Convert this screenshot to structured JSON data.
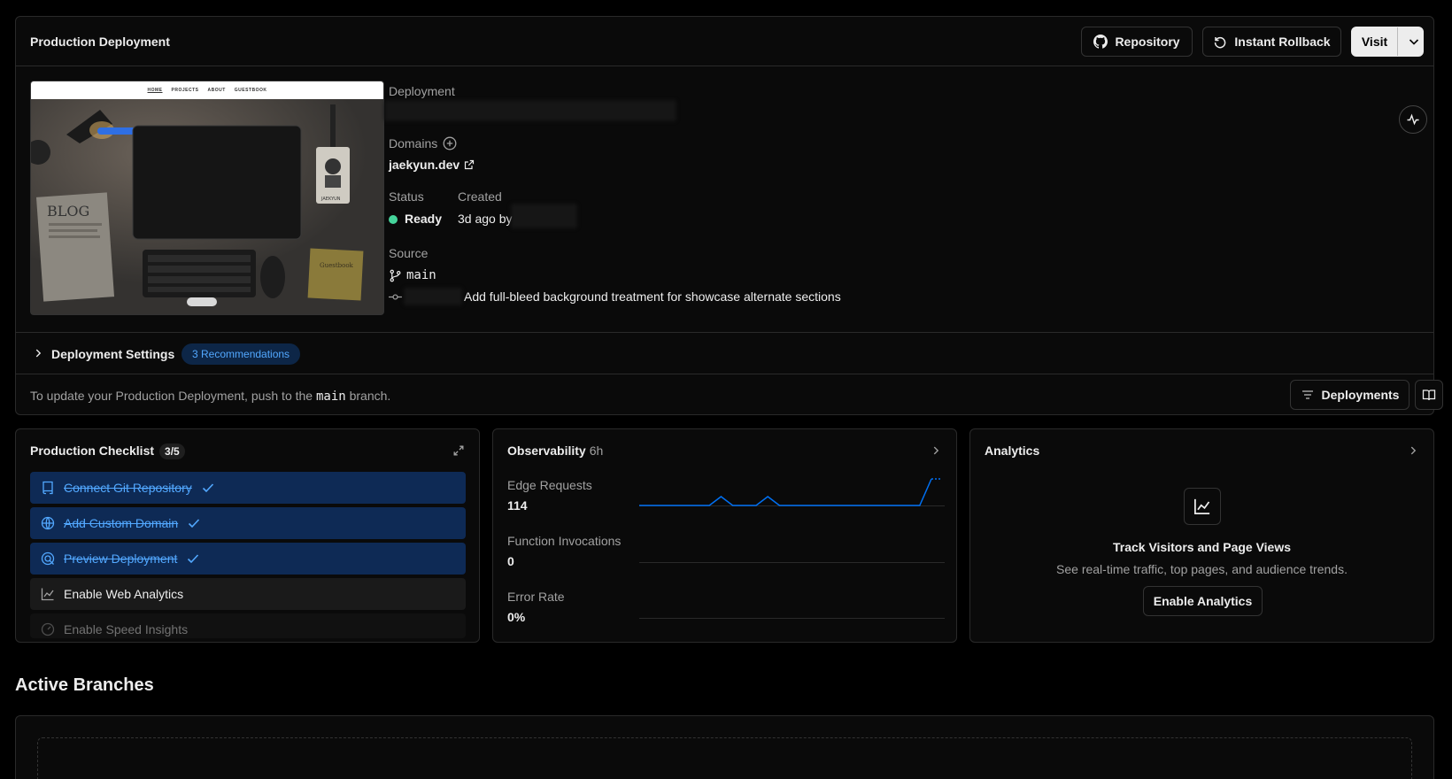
{
  "header": {
    "title": "Production Deployment",
    "repository_label": "Repository",
    "rollback_label": "Instant Rollback",
    "visit_label": "Visit"
  },
  "preview": {
    "nav": [
      "HOME",
      "PROJECTS",
      "ABOUT",
      "GUESTBOOK"
    ],
    "blog_label": "BLOG",
    "badge_name": "JAEKYUN",
    "note_label": "Guestbook"
  },
  "deployment": {
    "deployment_label": "Deployment",
    "domains_label": "Domains",
    "domain": "jaekyun.dev",
    "status_label": "Status",
    "status_value": "Ready",
    "created_label": "Created",
    "created_value": "3d ago by",
    "source_label": "Source",
    "branch": "main",
    "commit_message": "Add full-bleed background treatment for showcase alternate sections",
    "status_color": "#45d49b"
  },
  "settings": {
    "title": "Deployment Settings",
    "recommendations": "3 Recommendations"
  },
  "footer": {
    "note_prefix": "To update your Production Deployment, push to the",
    "note_branch": "main",
    "note_suffix": "branch.",
    "deployments_label": "Deployments"
  },
  "checklist": {
    "title": "Production Checklist",
    "count": "3/5",
    "items": [
      {
        "label": "Connect Git Repository",
        "done": true,
        "icon": "repo-icon"
      },
      {
        "label": "Add Custom Domain",
        "done": true,
        "icon": "globe-icon"
      },
      {
        "label": "Preview Deployment",
        "done": true,
        "icon": "preview-icon"
      },
      {
        "label": "Enable Web Analytics",
        "done": false,
        "icon": "chart-icon"
      },
      {
        "label": "Enable Speed Insights",
        "done": false,
        "icon": "gauge-icon"
      }
    ]
  },
  "observability": {
    "title": "Observability",
    "range": "6h",
    "metrics": [
      {
        "label": "Edge Requests",
        "value": "114"
      },
      {
        "label": "Function Invocations",
        "value": "0"
      },
      {
        "label": "Error Rate",
        "value": "0%"
      }
    ],
    "edge_series": [
      0,
      0,
      0,
      0,
      0,
      0,
      0,
      1,
      0,
      0,
      0,
      1,
      0,
      0,
      0,
      0,
      0,
      0,
      0,
      0,
      0,
      0,
      0,
      0,
      0,
      3
    ],
    "accent": "#0070f3"
  },
  "analytics": {
    "title": "Analytics",
    "heading": "Track Visitors and Page Views",
    "description": "See real-time traffic, top pages, and audience trends.",
    "button_label": "Enable Analytics"
  },
  "branches": {
    "title": "Active Branches"
  }
}
